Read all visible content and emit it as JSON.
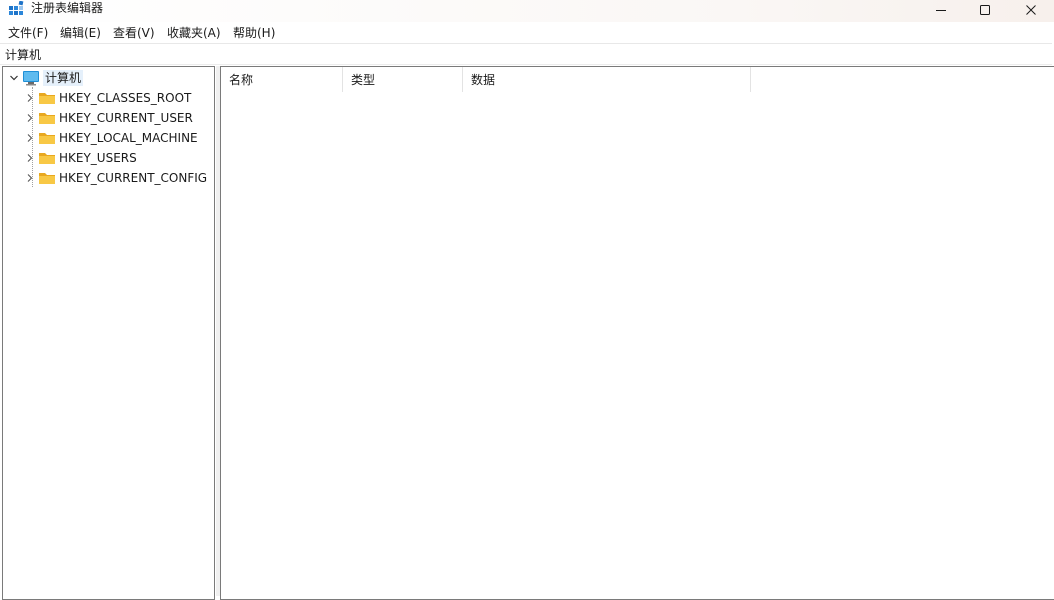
{
  "window": {
    "title": "注册表编辑器",
    "controls": {
      "minimize": "minimize-icon",
      "maximize": "maximize-icon",
      "close": "close-icon"
    }
  },
  "menu": {
    "file": "文件(F)",
    "edit": "编辑(E)",
    "view": "查看(V)",
    "favorites": "收藏夹(A)",
    "help": "帮助(H)"
  },
  "address": {
    "path": "计算机"
  },
  "tree": {
    "root": {
      "label": "计算机",
      "icon": "computer-icon",
      "expanded": true
    },
    "items": [
      {
        "label": "HKEY_CLASSES_ROOT",
        "icon": "folder-icon"
      },
      {
        "label": "HKEY_CURRENT_USER",
        "icon": "folder-icon"
      },
      {
        "label": "HKEY_LOCAL_MACHINE",
        "icon": "folder-icon"
      },
      {
        "label": "HKEY_USERS",
        "icon": "folder-icon"
      },
      {
        "label": "HKEY_CURRENT_CONFIG",
        "icon": "folder-icon"
      }
    ]
  },
  "list": {
    "columns": [
      "名称",
      "类型",
      "数据"
    ]
  },
  "colors": {
    "folder": "#F8C845",
    "folder_dark": "#E8A820",
    "selection": "#E5F0FB",
    "border": "#7A7A7A"
  }
}
